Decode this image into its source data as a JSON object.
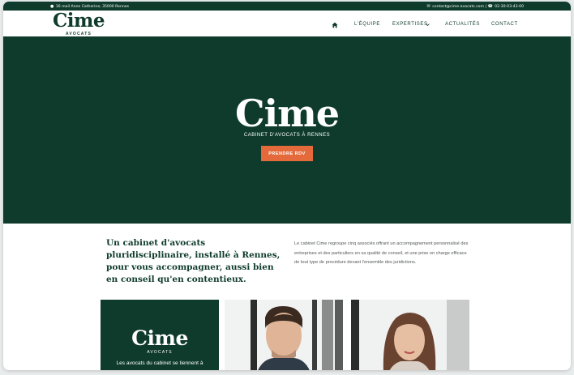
{
  "topbar": {
    "address": "16 mail Anne Catherine, 35000 Rennes",
    "email": "contact@cime-avocats.com",
    "separator": "|",
    "phone": "02-30-03-43-00"
  },
  "header": {
    "logo_word": "Cime",
    "logo_sub": "AVOCATS"
  },
  "nav": {
    "items": [
      {
        "label": "L'ÉQUIPE"
      },
      {
        "label": "EXPERTISES"
      },
      {
        "label": "ACTUALITÉS"
      },
      {
        "label": "CONTACT"
      }
    ],
    "dropdown_icon": "chevron-down-icon",
    "home_icon": "home-icon"
  },
  "hero": {
    "logo_word": "Cime",
    "subtitle": "CABINET D'AVOCATS À RENNES",
    "cta_label": "PRENDRE RDV"
  },
  "intro": {
    "heading": "Un cabinet d'avocats pluridisciplinaire, installé à Rennes, pour vous accompagner, aussi bien en conseil qu'en contentieux.",
    "text": "Le cabinet Cime regroupe cinq associés offrant un accompagnement personnalisé des entreprises et des particuliers en sa qualité de conseil, et une prise en charge efficace de tout type de procédure devant l'ensemble des juridictions."
  },
  "team_card": {
    "logo_word": "Cime",
    "logo_sub": "AVOCATS",
    "text": "Les avocats du cabinet se tiennent à"
  },
  "colors": {
    "brand_green": "#0e3b2c",
    "accent_orange": "#e46a3c",
    "white": "#ffffff"
  }
}
